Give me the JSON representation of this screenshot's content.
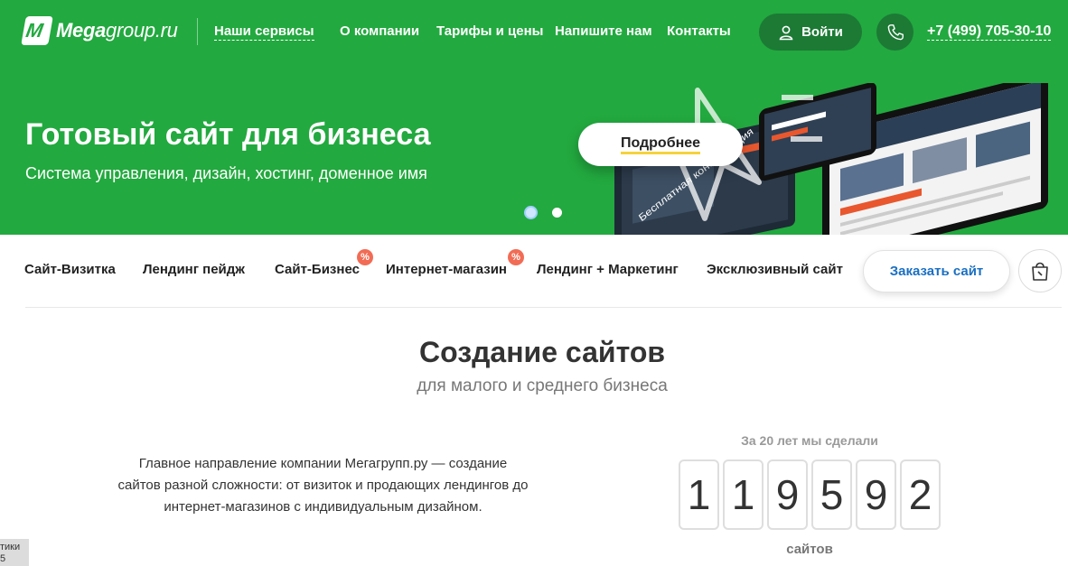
{
  "header": {
    "logo_text_bold": "Mega",
    "logo_text_rest": "group.ru",
    "nav": {
      "services": "Наши сервисы",
      "company": "О компании",
      "tariffs": "Тарифы и цены",
      "write": "Напишите нам",
      "contacts": "Контакты"
    },
    "login_label": "Войти",
    "phone": "+7 (499) 705-30-10"
  },
  "hero": {
    "title": "Готовый сайт для бизнеса",
    "subtitle": "Система управления, дизайн, хостинг, доменное имя",
    "more_label": "Подробнее",
    "mockup_caption": "Бесплатная консультация",
    "active_slide": 1,
    "slide_count": 2
  },
  "products": {
    "items": [
      "Сайт-Визитка",
      "Лендинг пейдж",
      "Сайт-Бизнес",
      "Интернет-магазин",
      "Лендинг + Маркетинг",
      "Эксклюзивный сайт"
    ],
    "badge_symbol": "%",
    "order_label": "Заказать сайт"
  },
  "main": {
    "title": "Создание сайтов",
    "subtitle": "для малого и среднего бизнеса",
    "description": "Главное направление компании Мегагрупп.ру — создание сайтов разной сложности: от визиток и продающих лендингов до интернет-магазинов с индивидуальным дизайном.",
    "counter_label": "За 20 лет мы сделали",
    "counter_digits": [
      "1",
      "1",
      "9",
      "5",
      "9",
      "2"
    ],
    "counter_unit": "сайтов"
  },
  "side_tab": {
    "text": "тики\n5"
  },
  "colors": {
    "brand_green": "#22a93f",
    "dark_green": "#1c7a35",
    "badge_red": "#f26c55",
    "link_blue": "#1a6fc2",
    "underline_yellow": "#f5d23b"
  },
  "icons": {
    "user": "user-icon",
    "phone": "phone-icon",
    "bag": "shopping-bag-icon"
  }
}
